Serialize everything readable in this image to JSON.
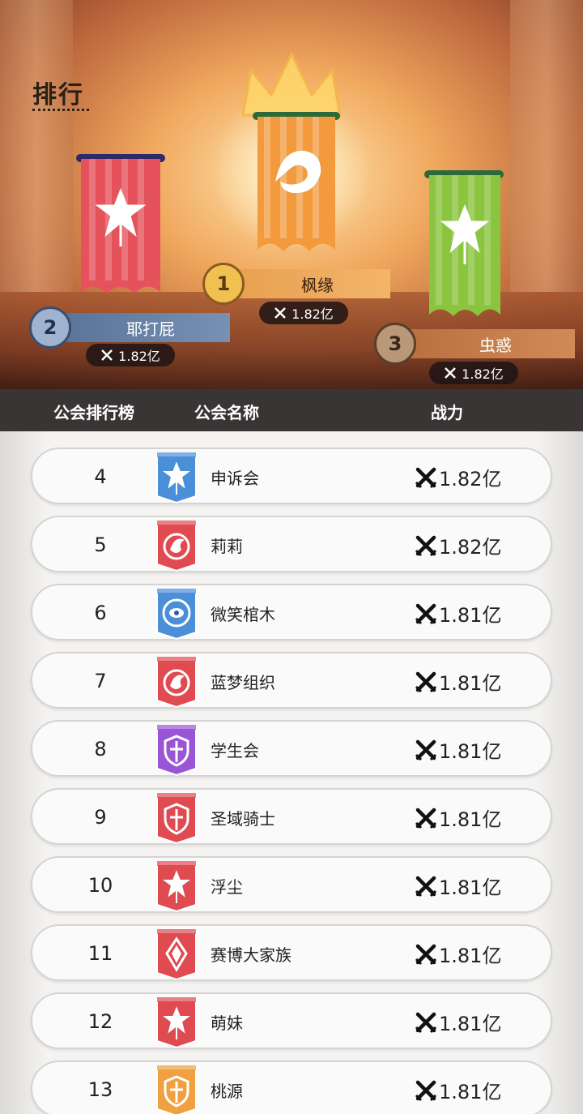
{
  "page": {
    "title": "排行"
  },
  "podium": [
    {
      "rank": "1",
      "name": "枫缘",
      "power": "1.82亿",
      "color": "#f39a3c",
      "emblem": "fox-emblem-icon"
    },
    {
      "rank": "2",
      "name": "耶打屁",
      "power": "1.82亿",
      "color": "#e5525b",
      "emblem": "sword-emblem-icon"
    },
    {
      "rank": "3",
      "name": "虫惑",
      "power": "1.82亿",
      "color": "#8bc540",
      "emblem": "sword-emblem-icon"
    }
  ],
  "table_header": {
    "rank": "公会排行榜",
    "name": "公会名称",
    "power": "战力"
  },
  "rows": [
    {
      "rank": "4",
      "name": "申诉会",
      "power": "1.82亿",
      "color": "#4a8fd8",
      "emblem": "sword-emblem-icon"
    },
    {
      "rank": "5",
      "name": "莉莉",
      "power": "1.82亿",
      "color": "#e04b52",
      "emblem": "dragon-emblem-icon"
    },
    {
      "rank": "6",
      "name": "微笑棺木",
      "power": "1.81亿",
      "color": "#4a8fd8",
      "emblem": "eye-emblem-icon"
    },
    {
      "rank": "7",
      "name": "蓝梦组织",
      "power": "1.81亿",
      "color": "#e04b52",
      "emblem": "dragon-emblem-icon"
    },
    {
      "rank": "8",
      "name": "学生会",
      "power": "1.81亿",
      "color": "#9a55d6",
      "emblem": "shield-emblem-icon"
    },
    {
      "rank": "9",
      "name": "圣域骑士",
      "power": "1.81亿",
      "color": "#e04b52",
      "emblem": "shield-emblem-icon"
    },
    {
      "rank": "10",
      "name": "浮尘",
      "power": "1.81亿",
      "color": "#e04b52",
      "emblem": "sword-emblem-icon"
    },
    {
      "rank": "11",
      "name": "赛博大家族",
      "power": "1.81亿",
      "color": "#e04b52",
      "emblem": "crystal-emblem-icon"
    },
    {
      "rank": "12",
      "name": "萌妹",
      "power": "1.81亿",
      "color": "#e04b52",
      "emblem": "sword-emblem-icon"
    },
    {
      "rank": "13",
      "name": "桃源",
      "power": "1.81亿",
      "color": "#f0a040",
      "emblem": "shield-emblem-icon"
    }
  ]
}
